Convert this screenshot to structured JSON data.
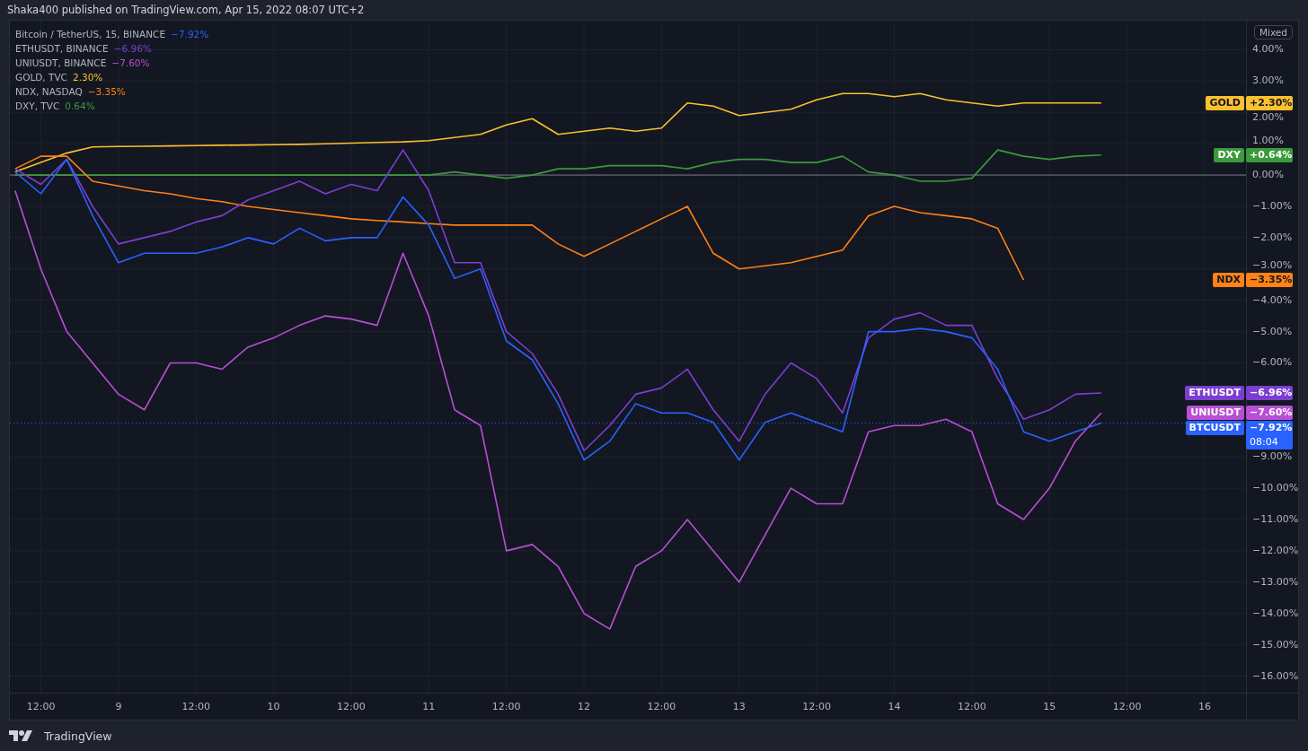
{
  "header": {
    "text": "Shaka400 published on TradingView.com, Apr 15, 2022 08:07 UTC+2"
  },
  "chart": {
    "legend": [
      {
        "name": "Bitcoin / TetherUS, 15, BINANCE",
        "change": "−7.92%",
        "color": "#2962ff"
      },
      {
        "name": "ETHUSDT, BINANCE",
        "change": "−6.96%",
        "color": "#7b3fd0"
      },
      {
        "name": "UNIUSDT, BINANCE",
        "change": "−7.60%",
        "color": "#b84fd4"
      },
      {
        "name": "GOLD, TVC",
        "change": "2.30%",
        "color": "#fbc02d"
      },
      {
        "name": "NDX, NASDAQ",
        "change": "−3.35%",
        "color": "#ff8214"
      },
      {
        "name": "DXY, TVC",
        "change": "0.64%",
        "color": "#3b9a3b"
      }
    ],
    "scale_button": "Mixed",
    "price_badges": [
      {
        "value": "+2.30%"
      },
      {
        "value": "+0.64%"
      },
      {
        "value": "−3.35%"
      },
      {
        "value": "−6.96%"
      },
      {
        "value": "−7.60%"
      },
      {
        "value": "−7.92%",
        "countdown": "08:04"
      }
    ],
    "chart_data": {
      "type": "line",
      "categories": [
        null,
        "12:00",
        null,
        null,
        "9",
        null,
        null,
        "12:00",
        null,
        null,
        "10",
        null,
        null,
        "12:00",
        null,
        null,
        "11",
        null,
        null,
        "12:00",
        null,
        null,
        "12",
        null,
        null,
        "12:00",
        null,
        null,
        "13",
        null,
        null,
        "12:00",
        null,
        null,
        "14",
        null,
        null,
        "12:00",
        null,
        null,
        "15",
        null,
        null,
        "12:00",
        null,
        null,
        "16"
      ],
      "ylim": [
        -16.53,
        4.93
      ],
      "grid": true,
      "legend": true,
      "series": [
        {
          "name": "GOLD",
          "color": "#fbc02d",
          "values": [
            0.1,
            0.4,
            0.7,
            0.9,
            0.91,
            0.92,
            0.93,
            0.94,
            0.95,
            0.96,
            0.97,
            0.98,
            1.0,
            1.02,
            1.04,
            1.06,
            1.1,
            1.2,
            1.3,
            1.6,
            1.8,
            1.3,
            1.4,
            1.5,
            1.4,
            1.5,
            2.3,
            2.2,
            1.9,
            2.0,
            2.1,
            2.4,
            2.6,
            2.6,
            2.5,
            2.6,
            2.4,
            2.3,
            2.2,
            2.3,
            2.3,
            2.3,
            2.3,
            null,
            null,
            null,
            null
          ]
        },
        {
          "name": "DXY",
          "color": "#3b9a3b",
          "values": [
            0,
            0,
            0,
            0,
            0,
            0,
            0,
            0,
            0,
            0,
            0,
            0,
            0,
            0,
            0,
            0,
            0,
            0.1,
            0.0,
            -0.1,
            0.0,
            0.2,
            0.2,
            0.3,
            0.3,
            0.3,
            0.2,
            0.4,
            0.5,
            0.5,
            0.4,
            0.4,
            0.6,
            0.1,
            0.0,
            -0.2,
            -0.2,
            -0.1,
            0.8,
            0.6,
            0.5,
            0.6,
            0.64,
            null,
            null,
            null,
            null
          ]
        },
        {
          "name": "NDX",
          "color": "#ff8214",
          "values": [
            0.2,
            0.6,
            0.6,
            -0.2,
            -0.35,
            -0.5,
            -0.6,
            -0.75,
            -0.85,
            -1.0,
            -1.1,
            -1.2,
            -1.3,
            -1.4,
            -1.45,
            -1.5,
            -1.55,
            -1.6,
            -1.6,
            -1.6,
            -1.6,
            -2.2,
            -2.6,
            -2.2,
            -1.8,
            -1.4,
            -1.0,
            -2.5,
            -3.0,
            -2.9,
            -2.8,
            -2.6,
            -2.4,
            -1.3,
            -1.0,
            -1.2,
            -1.3,
            -1.4,
            -1.7,
            -3.35,
            null,
            null,
            null,
            null,
            null,
            null,
            null
          ]
        },
        {
          "name": "ETHUSDT",
          "color": "#7b3fd0",
          "values": [
            0.2,
            -0.3,
            0.5,
            -1.0,
            -2.2,
            -2.0,
            -1.8,
            -1.5,
            -1.3,
            -0.8,
            -0.5,
            -0.2,
            -0.6,
            -0.3,
            -0.5,
            0.8,
            -0.5,
            -2.8,
            -2.8,
            -5.0,
            -5.7,
            -7.0,
            -8.8,
            -8.0,
            -7.0,
            -6.8,
            -6.2,
            -7.5,
            -8.5,
            -7.0,
            -6.0,
            -6.5,
            -7.6,
            -5.2,
            -4.6,
            -4.4,
            -4.8,
            -4.8,
            -6.5,
            -7.8,
            -7.5,
            -7.0,
            -6.96,
            null,
            null,
            null,
            null
          ]
        },
        {
          "name": "UNIUSDT",
          "color": "#b84fd4",
          "values": [
            -0.5,
            -3.0,
            -5.0,
            -6.0,
            -7.0,
            -7.5,
            -6.0,
            -6.0,
            -6.2,
            -5.5,
            -5.2,
            -4.8,
            -4.5,
            -4.6,
            -4.8,
            -2.5,
            -4.5,
            -7.5,
            -8.0,
            -12.0,
            -11.8,
            -12.5,
            -14.0,
            -14.5,
            -12.5,
            -12.0,
            -11.0,
            -12.0,
            -13.0,
            -11.5,
            -10.0,
            -10.5,
            -10.5,
            -8.2,
            -8.0,
            -8.0,
            -7.8,
            -8.2,
            -10.5,
            -11.0,
            -10.0,
            -8.5,
            -7.6,
            null,
            null,
            null,
            null
          ]
        },
        {
          "name": "BTCUSDT",
          "color": "#2962ff",
          "values": [
            0.1,
            -0.6,
            0.5,
            -1.3,
            -2.8,
            -2.5,
            -2.5,
            -2.5,
            -2.3,
            -2.0,
            -2.2,
            -1.7,
            -2.1,
            -2.0,
            -2.0,
            -0.7,
            -1.6,
            -3.3,
            -3.0,
            -5.3,
            -5.9,
            -7.3,
            -9.1,
            -8.5,
            -7.3,
            -7.6,
            -7.6,
            -7.9,
            -9.1,
            -7.9,
            -7.6,
            -7.9,
            -8.2,
            -5.0,
            -5.0,
            -4.9,
            -5.0,
            -5.2,
            -6.2,
            -8.2,
            -8.5,
            -8.2,
            -7.92,
            null,
            null,
            null,
            null
          ]
        }
      ],
      "yticks": [
        {
          "value": 4,
          "label": "4.00%"
        },
        {
          "value": 3,
          "label": "3.00%"
        },
        {
          "value": 2,
          "label": "2.00%"
        },
        {
          "value": 1,
          "label": "1.00%"
        },
        {
          "value": 0,
          "label": "0.00%"
        },
        {
          "value": -1,
          "label": "−1.00%"
        },
        {
          "value": -2,
          "label": "−2.00%"
        },
        {
          "value": -3,
          "label": "−3.00%"
        },
        {
          "value": -4,
          "label": "−4.00%"
        },
        {
          "value": -5,
          "label": "−5.00%"
        },
        {
          "value": -6,
          "label": "−6.00%"
        },
        {
          "value": -9,
          "label": "−9.00%"
        },
        {
          "value": -10,
          "label": "−10.00%"
        },
        {
          "value": -11,
          "label": "−11.00%"
        },
        {
          "value": -12,
          "label": "−12.00%"
        },
        {
          "value": -13,
          "label": "−13.00%"
        },
        {
          "value": -14,
          "label": "−14.00%"
        },
        {
          "value": -15,
          "label": "−15.00%"
        },
        {
          "value": -16,
          "label": "−16.00%"
        }
      ]
    }
  },
  "footer": {
    "brand": "TradingView"
  }
}
